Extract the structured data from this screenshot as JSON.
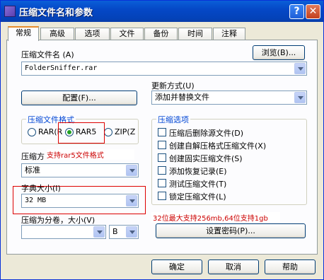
{
  "window": {
    "title": "压缩文件名和参数"
  },
  "titlebar": {
    "help": "?",
    "close": "✕"
  },
  "tabs": [
    "常规",
    "高级",
    "选项",
    "文件",
    "备份",
    "时间",
    "注释"
  ],
  "general": {
    "archive_name_label": "压缩文件名",
    "archive_name_hotkey": "(A)",
    "archive_name_value": "FolderSniffer.rar",
    "browse_button": "浏览(B)...",
    "update_mode_label": "更新方式",
    "update_mode_hotkey": "(U)",
    "update_mode_value": "添加并替换文件",
    "profiles_button": "配置(F)...",
    "format_group_title": "压缩文件格式",
    "format_options": [
      {
        "label": "RAR(R",
        "selected": false
      },
      {
        "label": "RAR5",
        "selected": true
      },
      {
        "label": "ZIP(Z",
        "selected": false
      }
    ],
    "compression_label": "压缩方",
    "compression_value": "标准",
    "dictionary_label": "字典大小(I)",
    "dictionary_value": "32 MB",
    "split_label": "压缩为分卷，大小(V)",
    "split_unit": "B",
    "options_group_title": "压缩选项",
    "options": [
      "压缩后删除源文件(D)",
      "创建自解压格式压缩文件(X)",
      "创建固实压缩文件(S)",
      "添加恢复记录(E)",
      "测试压缩文件(T)",
      "锁定压缩文件(L)"
    ],
    "set_password_button": "设置密码(P)..."
  },
  "annotations": {
    "rar5_note": "支持rar5文件格式",
    "dict_note": "32位最大支持256mb,64位支持1gb"
  },
  "footer": {
    "ok": "确定",
    "cancel": "取消",
    "help": "帮助"
  },
  "colors": {
    "title_bar": "#0548c7",
    "annotation": "#cc0000",
    "group_title": "#0046d5"
  }
}
